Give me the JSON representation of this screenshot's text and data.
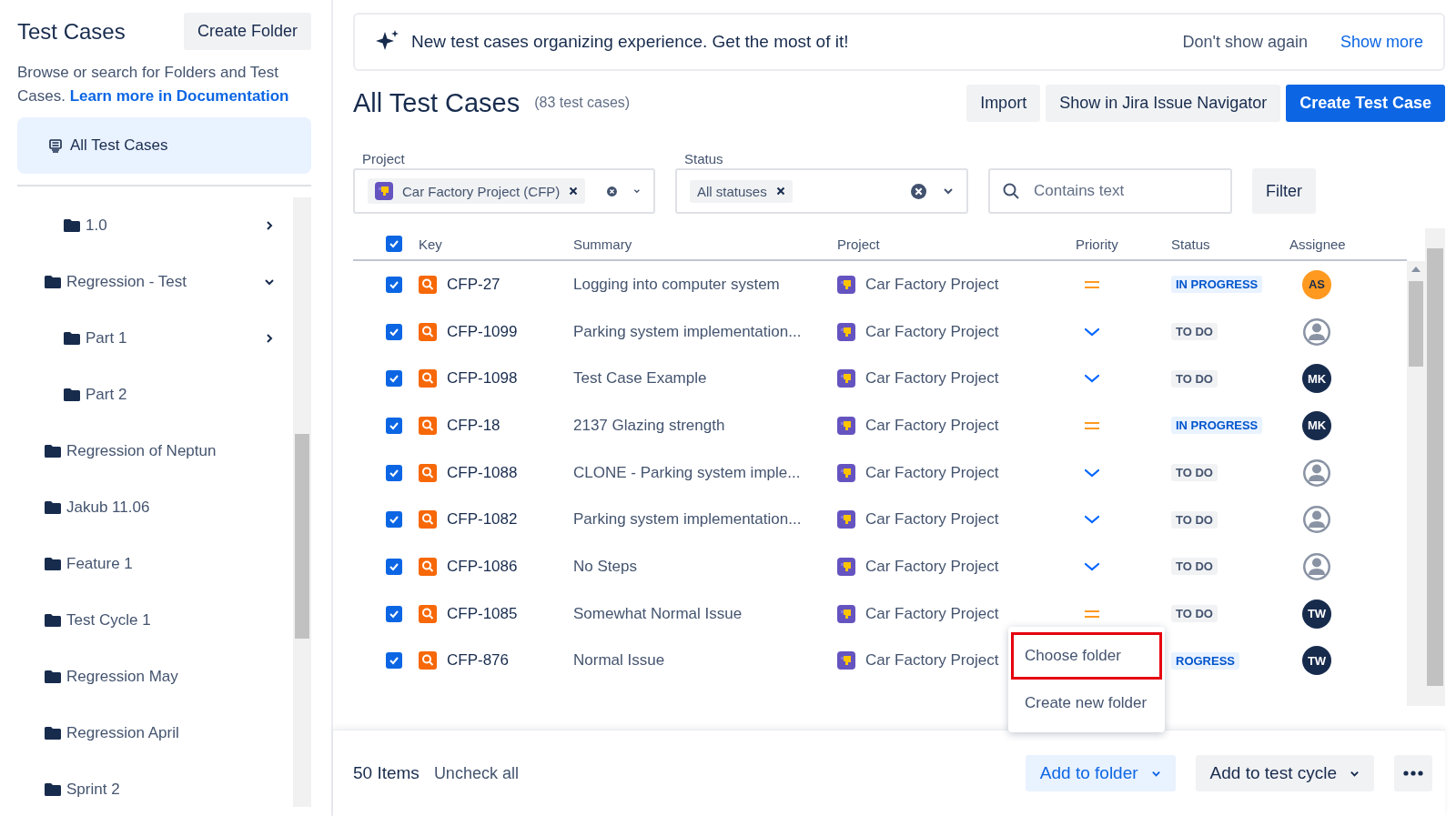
{
  "sidebar": {
    "title": "Test Cases",
    "create_button": "Create Folder",
    "description": "Browse or search for Folders and Test Cases.",
    "doc_link": "Learn more in Documentation",
    "all_item": {
      "label": "All Test Cases",
      "selected": true
    },
    "folders": [
      {
        "children": [
          {
            "label": "1.0",
            "expandable": true,
            "expanded": false
          }
        ]
      },
      {
        "label": "Regression - Test",
        "expandable": true,
        "expanded": true,
        "children": [
          {
            "label": "Part 1",
            "expandable": true,
            "expanded": false
          },
          {
            "label": "Part 2",
            "expandable": false
          }
        ]
      },
      {
        "label": "Regression of Neptun",
        "expandable": false
      },
      {
        "label": "Jakub 11.06",
        "expandable": false
      },
      {
        "label": "Feature 1",
        "expandable": false
      },
      {
        "label": "Test Cycle 1",
        "expandable": false
      },
      {
        "label": "Regression May",
        "expandable": false
      },
      {
        "label": "Regression April",
        "expandable": false
      },
      {
        "label": "Sprint 2",
        "expandable": false
      }
    ]
  },
  "banner": {
    "text": "New test cases organizing experience. Get the most of it!",
    "dismiss": "Don't show again",
    "more": "Show more"
  },
  "header": {
    "title": "All Test Cases",
    "count": "(83 test cases)",
    "buttons": [
      {
        "label": "Import",
        "primary": false
      },
      {
        "label": "Show in Jira Issue Navigator",
        "primary": false
      },
      {
        "label": "Create Test Case",
        "primary": true
      }
    ]
  },
  "filters": {
    "project": {
      "label": "Project",
      "tag": "Car Factory Project (CFP)"
    },
    "status": {
      "label": "Status",
      "tag": "All statuses"
    },
    "search": {
      "placeholder": "Contains text"
    },
    "button": "Filter"
  },
  "table": {
    "all_checked": true,
    "columns": [
      "Key",
      "Summary",
      "Project",
      "Priority",
      "Status",
      "Assignee"
    ],
    "rows": [
      {
        "checked": true,
        "key": "CFP-27",
        "summary": "Logging into computer system",
        "project": "Car Factory Project",
        "priority": {
          "kind": "medium"
        },
        "status": {
          "text": "IN PROGRESS",
          "kind": "progress"
        },
        "assignee": {
          "kind": "initials",
          "text": "AS",
          "color": "#ff991f"
        }
      },
      {
        "checked": true,
        "key": "CFP-1099",
        "summary": "Parking system implementation...",
        "project": "Car Factory Project",
        "priority": {
          "kind": "low"
        },
        "status": {
          "text": "TO DO",
          "kind": "todo"
        },
        "assignee": {
          "kind": "unassigned"
        }
      },
      {
        "checked": true,
        "key": "CFP-1098",
        "summary": "Test Case Example",
        "project": "Car Factory Project",
        "priority": {
          "kind": "low"
        },
        "status": {
          "text": "TO DO",
          "kind": "todo"
        },
        "assignee": {
          "kind": "initials",
          "text": "MK",
          "color": "#172b4d"
        }
      },
      {
        "checked": true,
        "key": "CFP-18",
        "summary": "2137 Glazing strength",
        "project": "Car Factory Project",
        "priority": {
          "kind": "medium"
        },
        "status": {
          "text": "IN PROGRESS",
          "kind": "progress"
        },
        "assignee": {
          "kind": "initials",
          "text": "MK",
          "color": "#172b4d"
        }
      },
      {
        "checked": true,
        "key": "CFP-1088",
        "summary": "CLONE - Parking system imple...",
        "project": "Car Factory Project",
        "priority": {
          "kind": "low"
        },
        "status": {
          "text": "TO DO",
          "kind": "todo"
        },
        "assignee": {
          "kind": "unassigned"
        }
      },
      {
        "checked": true,
        "key": "CFP-1082",
        "summary": "Parking system implementation...",
        "project": "Car Factory Project",
        "priority": {
          "kind": "low"
        },
        "status": {
          "text": "TO DO",
          "kind": "todo"
        },
        "assignee": {
          "kind": "unassigned"
        }
      },
      {
        "checked": true,
        "key": "CFP-1086",
        "summary": "No Steps",
        "project": "Car Factory Project",
        "priority": {
          "kind": "low"
        },
        "status": {
          "text": "TO DO",
          "kind": "todo"
        },
        "assignee": {
          "kind": "unassigned"
        }
      },
      {
        "checked": true,
        "key": "CFP-1085",
        "summary": "Somewhat Normal Issue",
        "project": "Car Factory Project",
        "priority": {
          "kind": "medium"
        },
        "status": {
          "text": "TO DO",
          "kind": "todo"
        },
        "assignee": {
          "kind": "initials",
          "text": "TW",
          "color": "#172b4d"
        }
      },
      {
        "checked": true,
        "key": "CFP-876",
        "summary": "Normal Issue",
        "project": "Car Factory Project",
        "status": {
          "text": "ROGRESS",
          "kind": "progress"
        },
        "assignee": {
          "kind": "initials",
          "text": "TW",
          "color": "#172b4d"
        }
      }
    ]
  },
  "menu": [
    {
      "label": "Choose folder",
      "highlighted": true
    },
    {
      "label": "Create new folder",
      "highlighted": false
    }
  ],
  "footer": {
    "count": "50 Items",
    "uncheck": "Uncheck all",
    "add_folder": "Add to folder",
    "add_cycle": "Add to test cycle"
  }
}
